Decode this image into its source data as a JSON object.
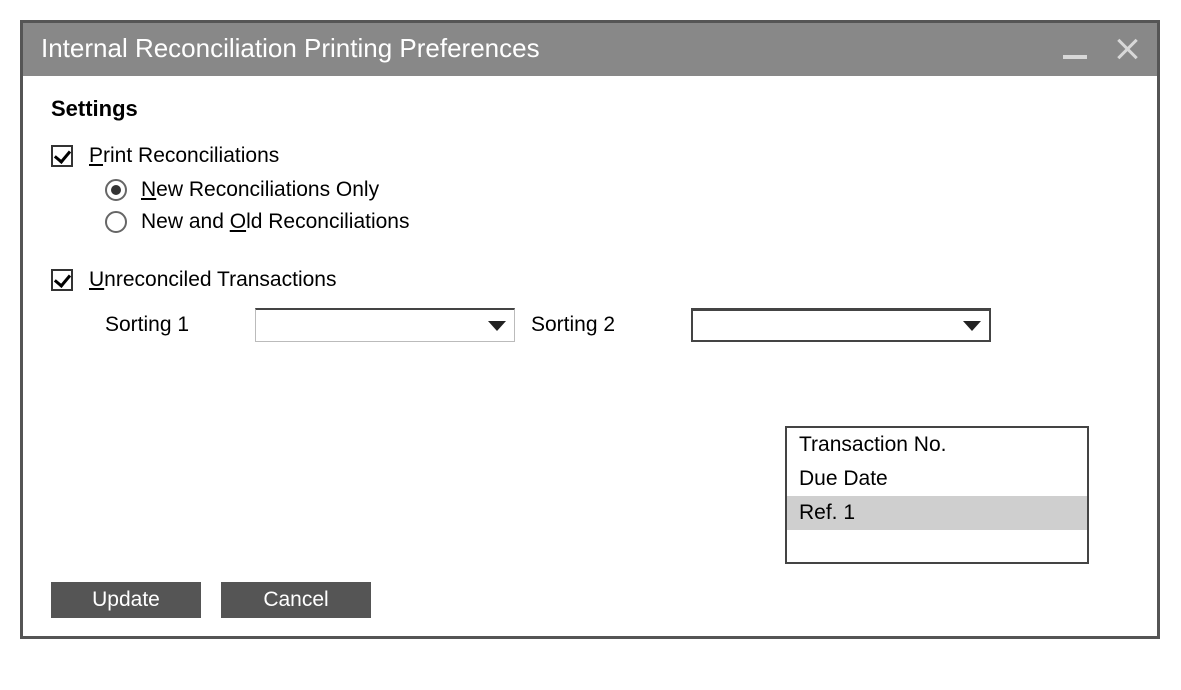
{
  "window": {
    "title": "Internal Reconciliation Printing Preferences"
  },
  "settings": {
    "header": "Settings",
    "printReconciliations": {
      "label_pre": "",
      "mnemonic": "P",
      "label_post": "rint Reconciliations",
      "checked": true,
      "options": {
        "newOnly": {
          "label_pre": "",
          "mnemonic": "N",
          "label_post": "ew Reconciliations Only",
          "selected": true
        },
        "newAndOld": {
          "label_pre": "New and ",
          "mnemonic": "O",
          "label_post": "ld Reconciliations",
          "selected": false
        }
      }
    },
    "unreconciled": {
      "label_pre": "",
      "mnemonic": "U",
      "label_post": "nreconciled Transactions",
      "checked": true,
      "sorting1": {
        "label": "Sorting 1",
        "value": ""
      },
      "sorting2": {
        "label": "Sorting 2",
        "value": "",
        "options": [
          "Transaction No.",
          "Due Date",
          "Ref. 1"
        ],
        "hover_index": 2
      }
    }
  },
  "buttons": {
    "update": "Update",
    "cancel": "Cancel"
  }
}
